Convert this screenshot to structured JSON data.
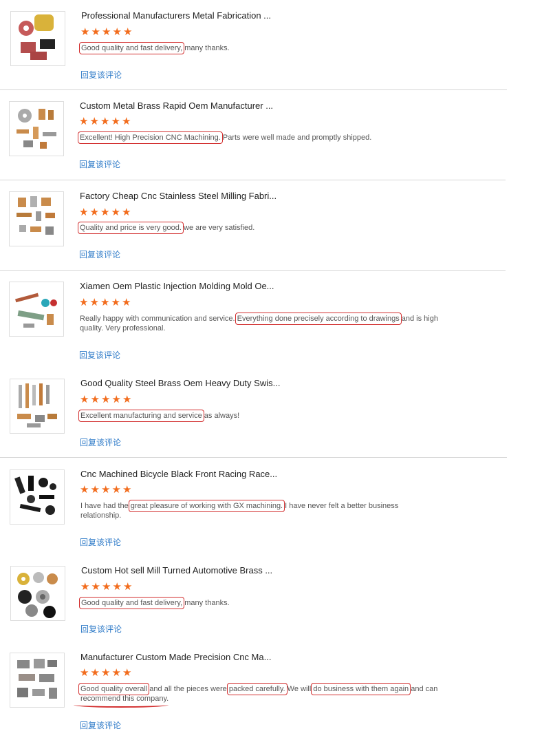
{
  "reply_label": "回复该评论",
  "stars": [
    "★",
    "★",
    "★",
    "★",
    "★"
  ],
  "reviews": [
    {
      "title": "Professional Manufacturers Metal Fabrication ...",
      "segments": [
        {
          "text": "Good quality and fast delivery,",
          "hl": true
        },
        {
          "text": " many thanks.",
          "hl": false
        }
      ]
    },
    {
      "title": "Custom Metal Brass Rapid Oem Manufacturer ...",
      "segments": [
        {
          "text": "Excellent! High Precision CNC Machining.",
          "hl": true
        },
        {
          "text": " Parts were well made and promptly shipped.",
          "hl": false
        }
      ]
    },
    {
      "title": "Factory Cheap Cnc Stainless Steel Milling Fabri...",
      "segments": [
        {
          "text": "Quality and price is very good.",
          "hl": true
        },
        {
          "text": " we are very satisfied.",
          "hl": false
        }
      ]
    },
    {
      "title": "Xiamen Oem Plastic Injection Molding Mold Oe...",
      "segments": [
        {
          "text": "Really happy with communication and service. ",
          "hl": false
        },
        {
          "text": "Everything done precisely according to drawings",
          "hl": true
        },
        {
          "text": " and is high quality. Very professional.",
          "hl": false
        }
      ]
    },
    {
      "title": "Good Quality Steel Brass Oem Heavy Duty Swis...",
      "segments": [
        {
          "text": "Excellent manufacturing and service",
          "hl": true
        },
        {
          "text": " as always!",
          "hl": false
        }
      ]
    },
    {
      "title": "Cnc Machined Bicycle Black Front Racing Race...",
      "segments": [
        {
          "text": "I have had the ",
          "hl": false
        },
        {
          "text": "great pleasure of working with GX machining.",
          "hl": true
        },
        {
          "text": " I have never felt a better business relationship.",
          "hl": false
        }
      ]
    },
    {
      "title": "Custom Hot sell Mill Turned Automotive Brass ...",
      "segments": [
        {
          "text": "Good quality and fast delivery,",
          "hl": true
        },
        {
          "text": " many thanks.",
          "hl": false
        }
      ]
    },
    {
      "title": "Manufacturer Custom Made Precision Cnc Ma...",
      "segments": [
        {
          "text": "Good quality overall",
          "hl": true
        },
        {
          "text": " and all the pieces were ",
          "hl": false
        },
        {
          "text": "packed carefully.",
          "hl": true
        },
        {
          "text": " We will ",
          "hl": false
        },
        {
          "text": "do business with them again",
          "hl": true
        },
        {
          "text": " and can recommend this company.",
          "hl": false
        }
      ]
    }
  ]
}
